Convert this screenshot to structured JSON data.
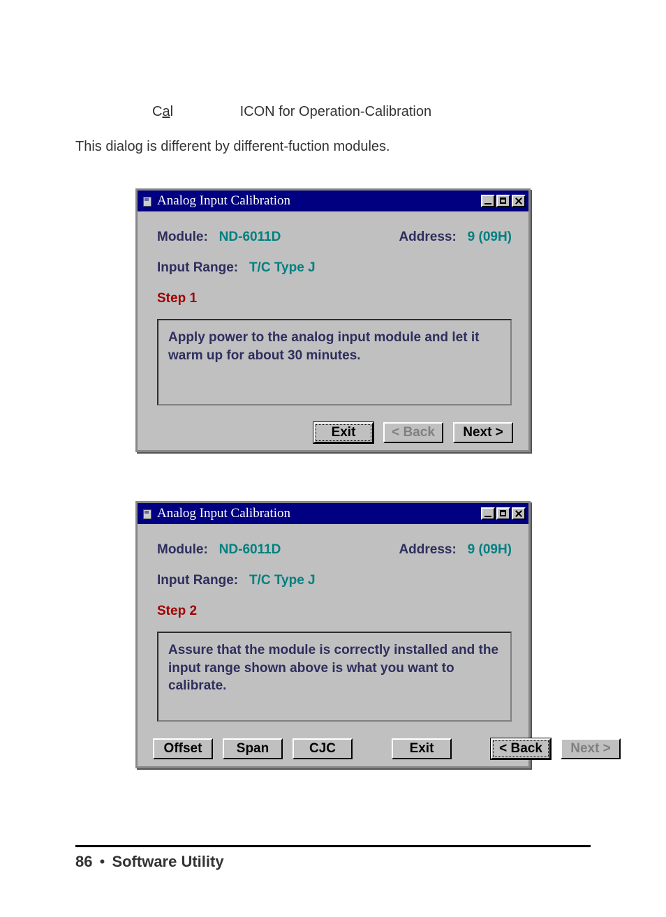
{
  "intro": {
    "cal_c": "C",
    "cal_a": "a",
    "cal_l": "l",
    "cal_desc": "ICON for Operation-Calibration",
    "line2": "This dialog is different by different-fuction modules."
  },
  "dialog1": {
    "title": "Analog Input Calibration",
    "module_lbl": "Module:",
    "module_val": "ND-6011D",
    "address_lbl": "Address:",
    "address_val": "9 (09H)",
    "range_lbl": "Input Range:",
    "range_val": "T/C Type J",
    "step_lbl": "Step 1",
    "step_text": "Apply power to the analog input module and let it warm up for about 30 minutes.",
    "btn_exit": "Exit",
    "btn_back": "< Back",
    "btn_next": "Next >"
  },
  "dialog2": {
    "title": "Analog Input Calibration",
    "module_lbl": "Module:",
    "module_val": "ND-6011D",
    "address_lbl": "Address:",
    "address_val": "9 (09H)",
    "range_lbl": "Input Range:",
    "range_val": "T/C Type J",
    "step_lbl": "Step 2",
    "step_text": "Assure that the module is correctly installed and the input range shown above is what you want to calibrate.",
    "btn_offset": "Offset",
    "btn_span": "Span",
    "btn_cjc": "CJC",
    "btn_exit": "Exit",
    "btn_back": "< Back",
    "btn_next": "Next >"
  },
  "footer": {
    "page_num": "86",
    "bullet": "•",
    "section": "Software Utility"
  }
}
